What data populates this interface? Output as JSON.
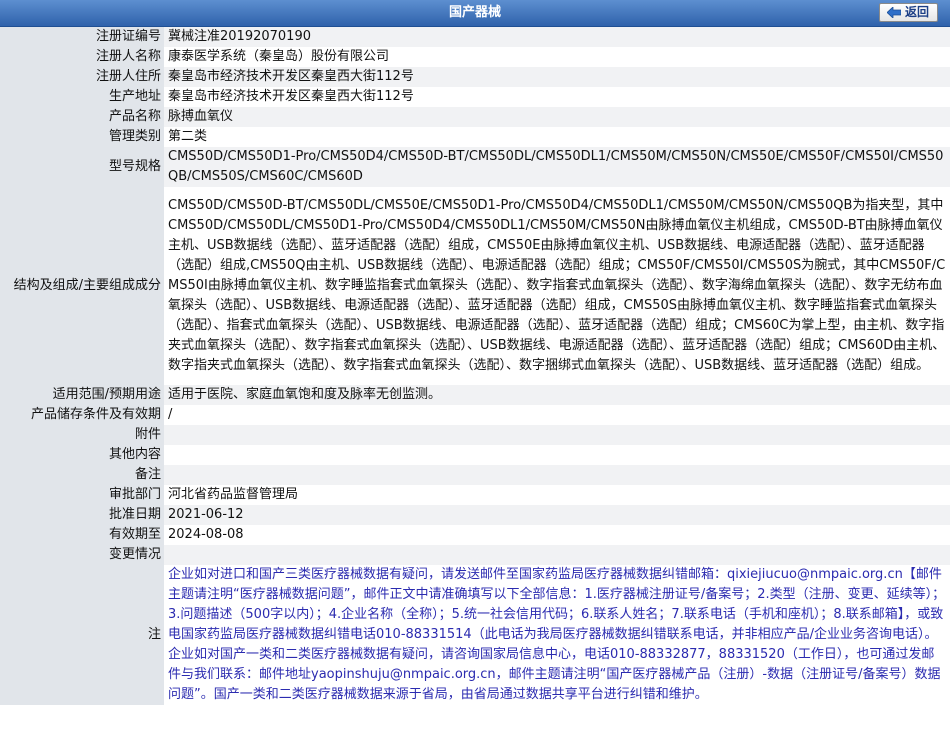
{
  "header": {
    "title": "国产器械",
    "back_label": "返回",
    "bar_color": "#3a6db5"
  },
  "rows": [
    {
      "label": "注册证编号",
      "value": "冀械注准20192070190"
    },
    {
      "label": "注册人名称",
      "value": "康泰医学系统（秦皇岛）股份有限公司"
    },
    {
      "label": "注册人住所",
      "value": "秦皇岛市经济技术开发区秦皇西大街112号"
    },
    {
      "label": "生产地址",
      "value": "秦皇岛市经济技术开发区秦皇西大街112号"
    },
    {
      "label": "产品名称",
      "value": "脉搏血氧仪"
    },
    {
      "label": "管理类别",
      "value": "第二类"
    },
    {
      "label": "型号规格",
      "value": "CMS50D/CMS50D1-Pro/CMS50D4/CMS50D-BT/CMS50DL/CMS50DL1/CMS50M/CMS50N/CMS50E/CMS50F/CMS50I/CMS50QB/CMS50S/CMS60C/CMS60D"
    },
    {
      "label": "结构及组成/主要组成成分",
      "value": "CMS50D/CMS50D-BT/CMS50DL/CMS50E/CMS50D1-Pro/CMS50D4/CMS50DL1/CMS50M/CMS50N/CMS50QB为指夹型，其中CMS50D/CMS50DL/CMS50D1-Pro/CMS50D4/CMS50DL1/CMS50M/CMS50N由脉搏血氧仪主机组成，CMS50D-BT由脉搏血氧仪主机、USB数据线（选配）、蓝牙适配器（选配）组成，CMS50E由脉搏血氧仪主机、USB数据线、电源适配器（选配）、蓝牙适配器（选配）组成,CMS50Q由主机、USB数据线（选配）、电源适配器（选配）组成；CMS50F/CMS50I/CMS50S为腕式，其中CMS50F/CMS50I由脉搏血氧仪主机、数字睡监指套式血氧探头（选配）、数字指套式血氧探头（选配）、数字海绵血氧探头（选配）、数字无纺布血氧探头（选配）、USB数据线、电源适配器（选配）、蓝牙适配器（选配）组成，CMS50S由脉搏血氧仪主机、数字睡监指套式血氧探头（选配）、指套式血氧探头（选配）、USB数据线、电源适配器（选配）、蓝牙适配器（选配）组成；CMS60C为掌上型，由主机、数字指夹式血氧探头（选配）、数字指套式血氧探头（选配）、USB数据线、电源适配器（选配）、蓝牙适配器（选配）组成；CMS60D由主机、数字指夹式血氧探头（选配）、数字指套式血氧探头（选配）、数字捆绑式血氧探头（选配）、USB数据线、蓝牙适配器（选配）组成。"
    },
    {
      "label": "适用范围/预期用途",
      "value": "适用于医院、家庭血氧饱和度及脉率无创监测。"
    },
    {
      "label": "产品储存条件及有效期",
      "value": "/"
    },
    {
      "label": "附件",
      "value": ""
    },
    {
      "label": "其他内容",
      "value": ""
    },
    {
      "label": "备注",
      "value": ""
    },
    {
      "label": "审批部门",
      "value": "河北省药品监督管理局"
    },
    {
      "label": "批准日期",
      "value": "2021-06-12"
    },
    {
      "label": "有效期至",
      "value": "2024-08-08"
    },
    {
      "label": "变更情况",
      "value": ""
    }
  ],
  "notice": {
    "label": "注",
    "text": "企业如对进口和国产三类医疗器械数据有疑问，请发送邮件至国家药监局医疗器械数据纠错邮箱：qixiejiucuo@nmpaic.org.cn【邮件主题请注明“医疗器械数据问题”，邮件正文中请准确填写以下全部信息：1.医疗器械注册证号/备案号；2.类型（注册、变更、延续等）；3.问题描述（500字以内）；4.企业名称（全称）；5.统一社会信用代码；6.联系人姓名；7.联系电话（手机和座机）；8.联系邮箱】，或致电国家药监局医疗器械数据纠错电话010-88331514（此电话为我局医疗器械数据纠错联系电话，并非相应产品/企业业务咨询电话）。企业如对国产一类和二类医疗器械数据有疑问，请咨询国家局信息中心，电话010-88332877，88331520（工作日），也可通过发邮件与我们联系：邮件地址yaopinshuju@nmpaic.org.cn，邮件主题请注明“国产医疗器械产品（注册）-数据（注册证号/备案号）数据问题”。国产一类和二类医疗器械数据来源于省局，由省局通过数据共享平台进行纠错和维护。",
    "color": "#2b2bb0"
  }
}
